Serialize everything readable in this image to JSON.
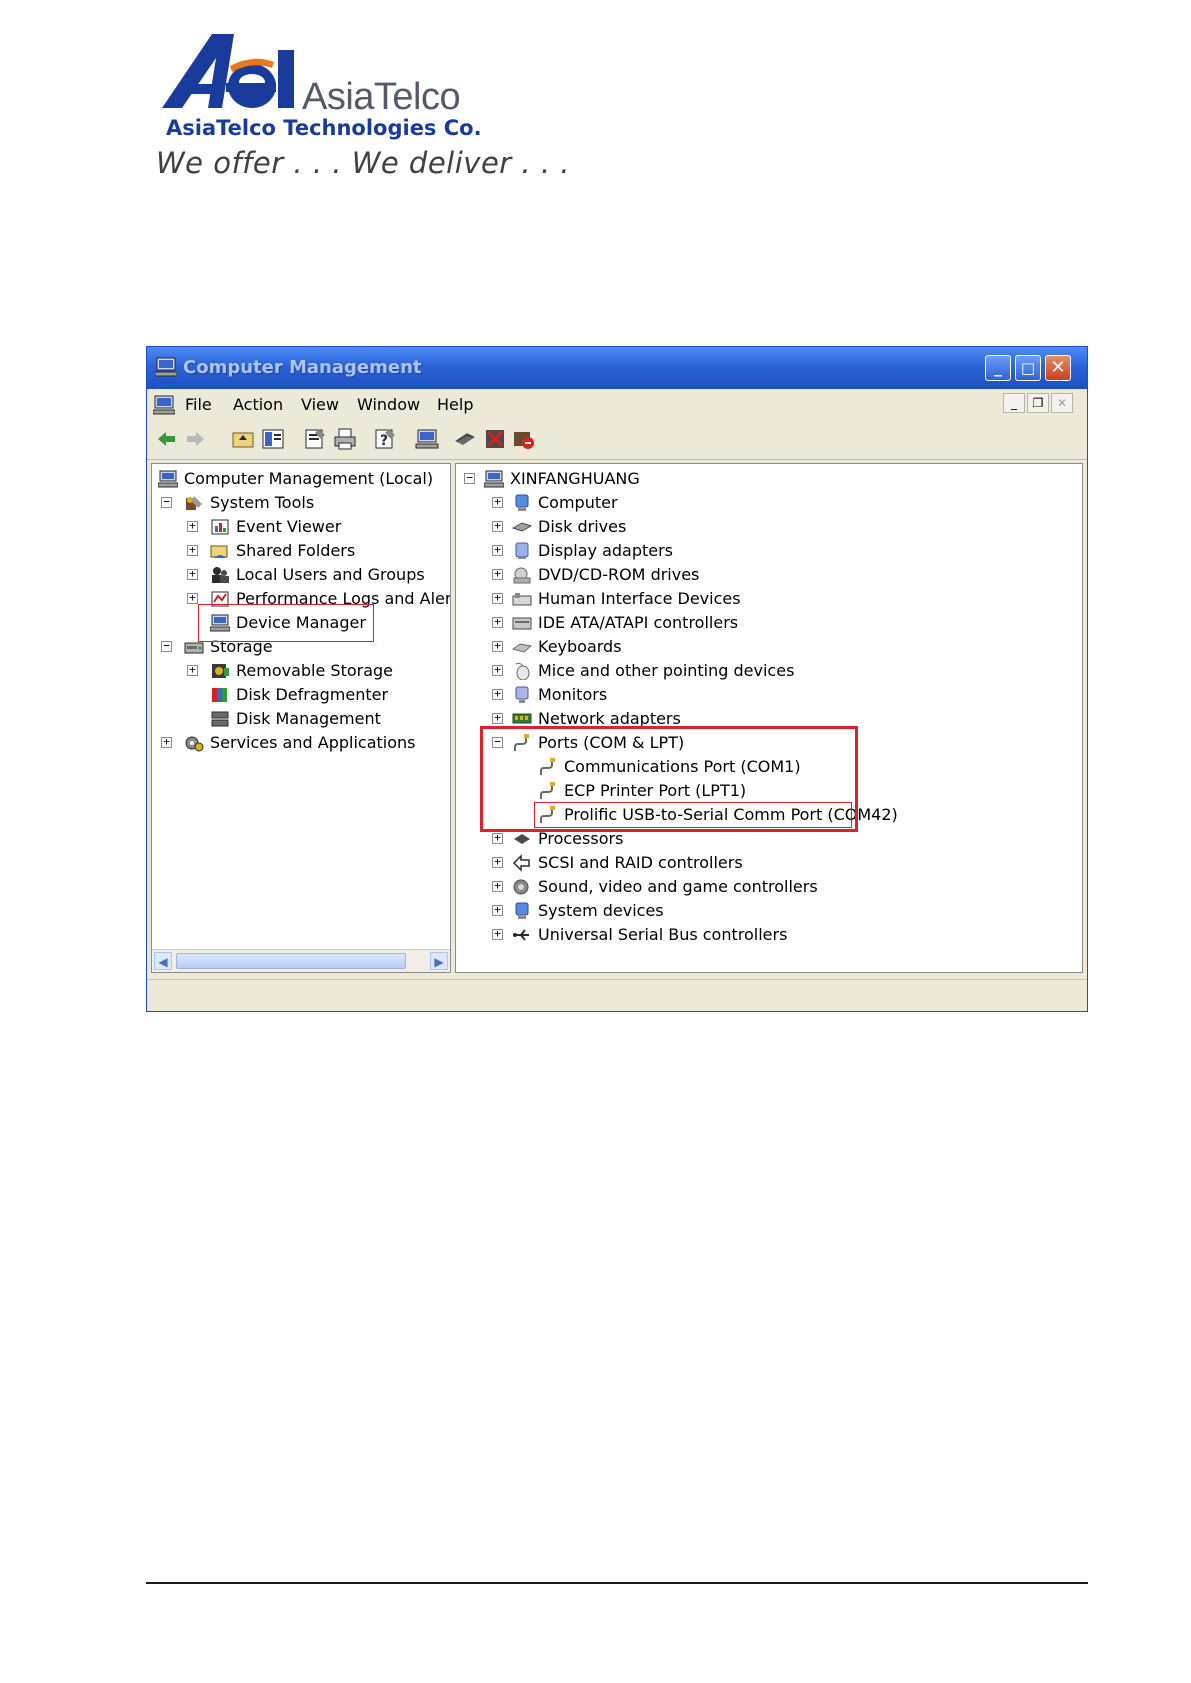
{
  "letterhead": {
    "logo_mark": "Ael",
    "brand_name": "AsiaTelco",
    "company_name": "AsiaTelco Technologies Co.",
    "tagline": "We offer . . . We deliver . . ."
  },
  "window": {
    "title": "Computer Management",
    "menu": [
      "File",
      "Action",
      "View",
      "Window",
      "Help"
    ],
    "left_tree": [
      {
        "label": "Computer Management (Local)",
        "icon": "computer-management-icon"
      },
      {
        "label": "System Tools",
        "icon": "system-tools-icon",
        "expander": "minus"
      },
      {
        "label": "Event Viewer",
        "icon": "event-viewer-icon",
        "expander": "plus"
      },
      {
        "label": "Shared Folders",
        "icon": "shared-folders-icon",
        "expander": "plus"
      },
      {
        "label": "Local Users and Groups",
        "icon": "users-icon",
        "expander": "plus"
      },
      {
        "label": "Performance Logs and Alerts",
        "icon": "performance-icon",
        "expander": "plus"
      },
      {
        "label": "Device Manager",
        "icon": "device-manager-icon"
      },
      {
        "label": "Storage",
        "icon": "storage-icon",
        "expander": "minus"
      },
      {
        "label": "Removable Storage",
        "icon": "removable-storage-icon",
        "expander": "plus"
      },
      {
        "label": "Disk Defragmenter",
        "icon": "defragmenter-icon"
      },
      {
        "label": "Disk Management",
        "icon": "disk-management-icon"
      },
      {
        "label": "Services and Applications",
        "icon": "services-icon",
        "expander": "plus"
      }
    ],
    "right_tree": [
      {
        "label": "XINFANGHUANG",
        "icon": "computer-icon",
        "expander": "minus"
      },
      {
        "label": "Computer",
        "icon": "computer-icon",
        "expander": "plus"
      },
      {
        "label": "Disk drives",
        "icon": "disk-drive-icon",
        "expander": "plus"
      },
      {
        "label": "Display adapters",
        "icon": "display-adapter-icon",
        "expander": "plus"
      },
      {
        "label": "DVD/CD-ROM drives",
        "icon": "dvd-drive-icon",
        "expander": "plus"
      },
      {
        "label": "Human Interface Devices",
        "icon": "hid-icon",
        "expander": "plus"
      },
      {
        "label": "IDE ATA/ATAPI controllers",
        "icon": "ide-controller-icon",
        "expander": "plus"
      },
      {
        "label": "Keyboards",
        "icon": "keyboard-icon",
        "expander": "plus"
      },
      {
        "label": "Mice and other pointing devices",
        "icon": "mouse-icon",
        "expander": "plus"
      },
      {
        "label": "Monitors",
        "icon": "monitor-icon",
        "expander": "plus"
      },
      {
        "label": "Network adapters",
        "icon": "network-adapter-icon",
        "expander": "plus"
      },
      {
        "label": "Ports (COM & LPT)",
        "icon": "port-icon",
        "expander": "minus"
      },
      {
        "label": "Communications Port (COM1)",
        "icon": "port-icon"
      },
      {
        "label": "ECP Printer Port (LPT1)",
        "icon": "port-icon"
      },
      {
        "label": "Prolific USB-to-Serial Comm Port (COM42)",
        "icon": "port-icon"
      },
      {
        "label": "Processors",
        "icon": "processor-icon",
        "expander": "plus"
      },
      {
        "label": "SCSI and RAID controllers",
        "icon": "scsi-icon",
        "expander": "plus"
      },
      {
        "label": "Sound, video and game controllers",
        "icon": "sound-icon",
        "expander": "plus"
      },
      {
        "label": "System devices",
        "icon": "system-devices-icon",
        "expander": "plus"
      },
      {
        "label": "Universal Serial Bus controllers",
        "icon": "usb-icon",
        "expander": "plus"
      }
    ]
  },
  "colors": {
    "highlight_box": "#e0202a",
    "logo_blue": "#1a3a9c",
    "logo_orange": "#e8781a",
    "titlebar_blue": "#2b63d9"
  }
}
